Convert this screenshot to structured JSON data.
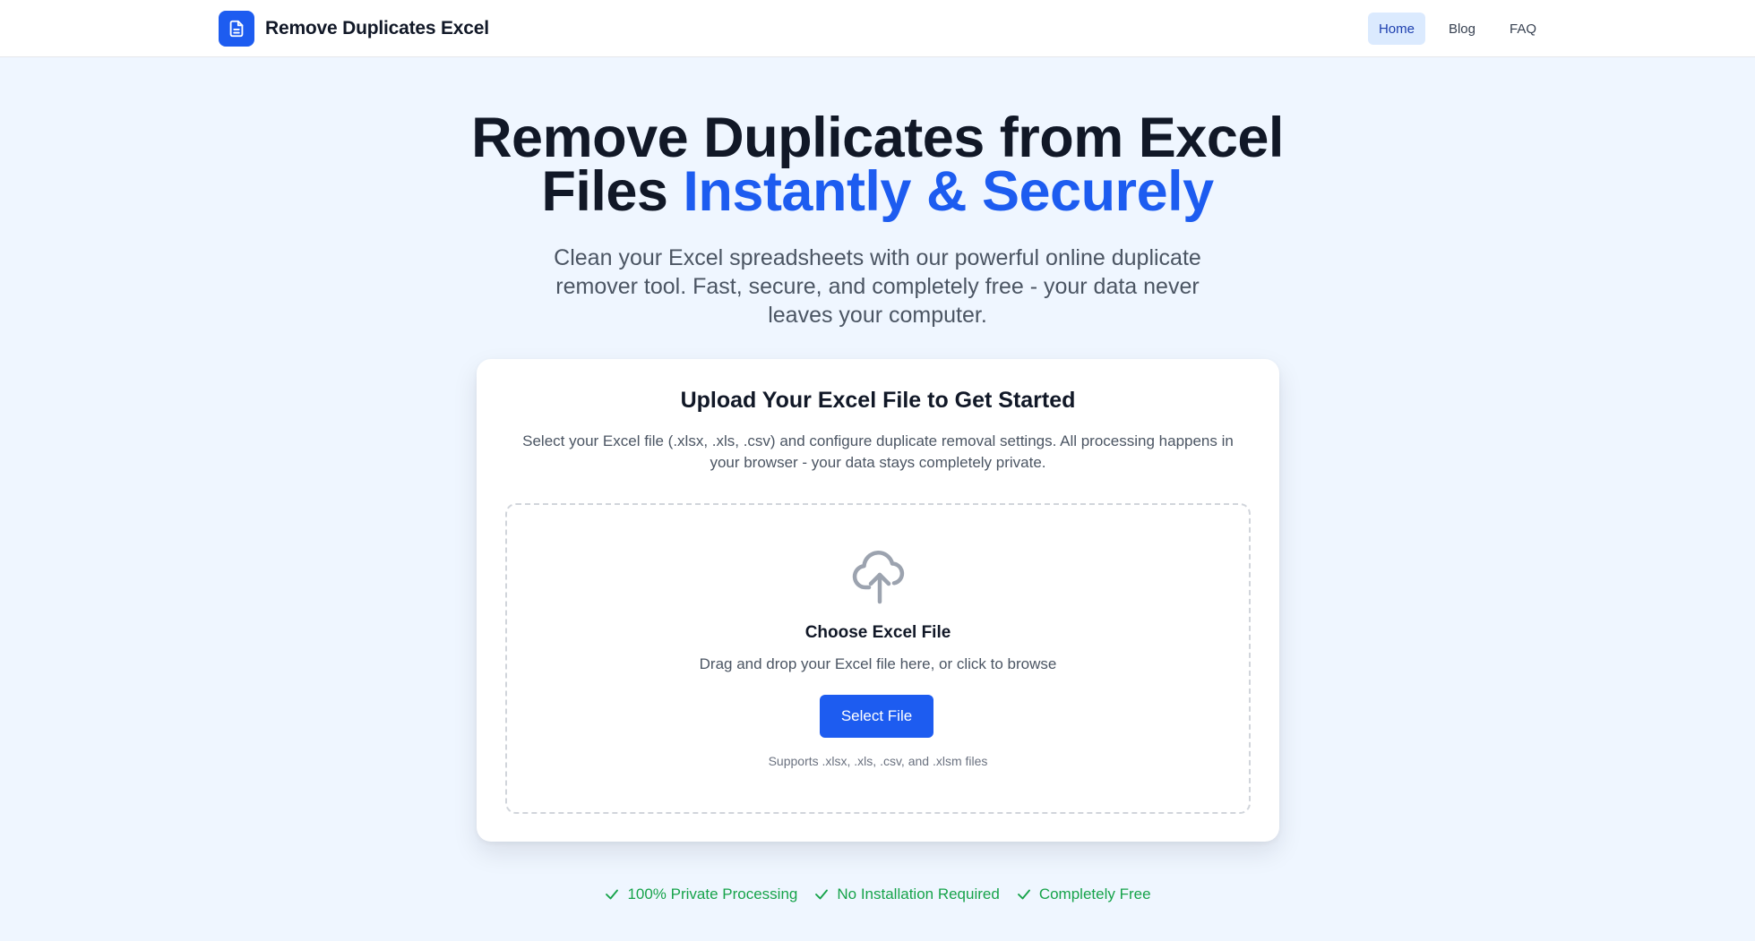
{
  "header": {
    "brand_name": "Remove Duplicates Excel",
    "brand_icon": "document-icon",
    "nav": [
      {
        "label": "Home",
        "active": true
      },
      {
        "label": "Blog",
        "active": false
      },
      {
        "label": "FAQ",
        "active": false
      }
    ]
  },
  "hero": {
    "title_line1": "Remove Duplicates from Excel",
    "title_line2_plain": "Files ",
    "title_line2_accent": "Instantly & Securely",
    "subtitle": "Clean your Excel spreadsheets with our powerful online duplicate remover tool. Fast, secure, and completely free - your data never leaves your computer."
  },
  "upload_card": {
    "title": "Upload Your Excel File to Get Started",
    "description": "Select your Excel file (.xlsx, .xls, .csv) and configure duplicate removal settings. All processing happens in your browser - your data stays completely private.",
    "dropzone": {
      "icon": "cloud-upload-icon",
      "title": "Choose Excel File",
      "hint": "Drag and drop your Excel file here, or click to browse",
      "button_label": "Select File",
      "support_text": "Supports .xlsx, .xls, .csv, and .xlsm files"
    }
  },
  "features": [
    {
      "label": "100% Private Processing",
      "icon": "check-icon"
    },
    {
      "label": "No Installation Required",
      "icon": "check-icon"
    },
    {
      "label": "Completely Free",
      "icon": "check-icon"
    }
  ],
  "colors": {
    "accent": "#1d5cf0",
    "background": "#eff6ff",
    "success": "#16a34a",
    "nav_active_bg": "#dbeafe"
  }
}
